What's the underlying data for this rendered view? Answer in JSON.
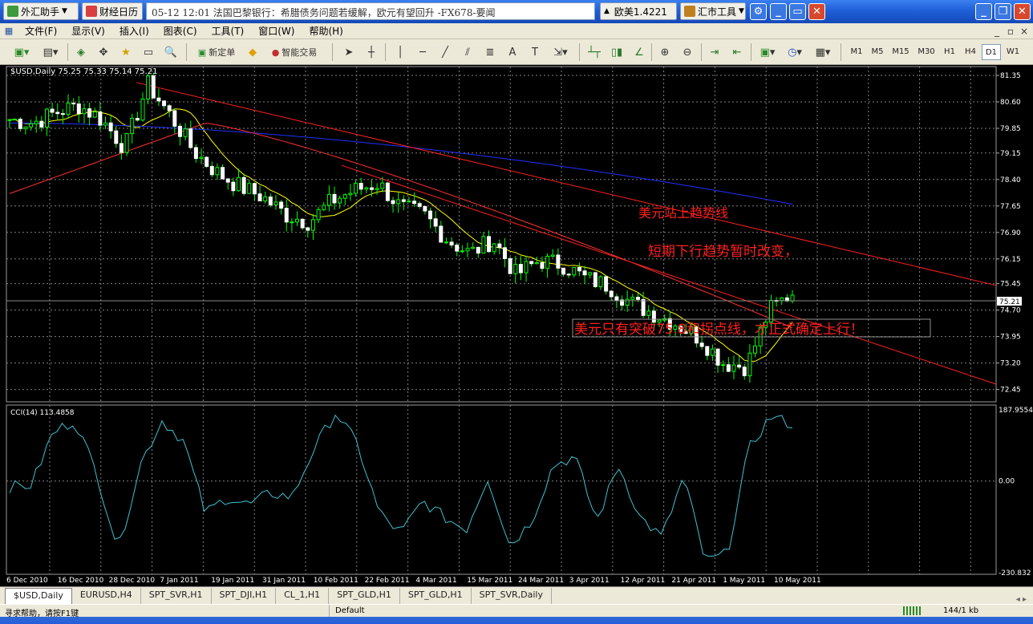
{
  "titlebar": {
    "app_button": "外汇助手",
    "calendar_button": "财经日历",
    "news_ticker": "05-12 12:01 法国巴黎银行：希腊债务问题若缓解，欧元有望回升  -FX678-要闻",
    "quote": "欧美1.4221",
    "tools_button": "汇市工具"
  },
  "menu": [
    "文件(F)",
    "显示(V)",
    "插入(I)",
    "图表(C)",
    "工具(T)",
    "窗口(W)",
    "帮助(H)"
  ],
  "toolbar": {
    "new_order": "新定单",
    "expert_trading": "智能交易",
    "periods": [
      "M1",
      "M5",
      "M15",
      "M30",
      "H1",
      "H4",
      "D1",
      "W1"
    ],
    "active_period": "D1"
  },
  "chart": {
    "header": "$USD,Daily  75.25 75.33 75.14 75.21",
    "price_labels": [
      "81.35",
      "80.60",
      "79.85",
      "79.15",
      "78.40",
      "77.65",
      "76.90",
      "76.15",
      "75.45",
      "74.70",
      "73.95",
      "73.20",
      "72.45"
    ],
    "current_price": "75.21",
    "date_labels": [
      "6 Dec 2010",
      "16 Dec 2010",
      "28 Dec 2010",
      "7 Jan 2011",
      "19 Jan 2011",
      "31 Jan 2011",
      "10 Feb 2011",
      "22 Feb 2011",
      "4 Mar 2011",
      "15 Mar 2011",
      "24 Mar 2011",
      "3 Apr 2011",
      "12 Apr 2011",
      "21 Apr 2011",
      "1 May 2011",
      "10 May 2011"
    ],
    "annotations": [
      "美元站上趋势线",
      "短期下行趋势暂时改变，",
      "美元只有突破75.8和拐点线，才正式确定上行！"
    ],
    "indicator_header": "CCI(14) 113.4858",
    "cci_labels": [
      "187.9554",
      "0.00",
      "-230.832"
    ],
    "colors": {
      "bull": "#00ff00",
      "bear": "#ffffff",
      "trendline": "#ff2020",
      "ma_short": "#ffff00",
      "ma_mid": "#ff3030",
      "ma_long": "#2030ff",
      "cci": "#40c0d0",
      "grid": "#808080"
    }
  },
  "chart_data": {
    "type": "candlestick",
    "title": "$USD,Daily",
    "ylim": [
      72.1,
      81.6
    ],
    "x": [
      "6 Dec 2010",
      "16 Dec 2010",
      "28 Dec 2010",
      "7 Jan 2011",
      "19 Jan 2011",
      "31 Jan 2011",
      "10 Feb 2011",
      "22 Feb 2011",
      "4 Mar 2011",
      "15 Mar 2011",
      "24 Mar 2011",
      "3 Apr 2011",
      "12 Apr 2011",
      "21 Apr 2011",
      "1 May 2011",
      "10 May 2011"
    ],
    "close_path": [
      80.1,
      80.0,
      80.3,
      80.5,
      80.1,
      79.3,
      81.1,
      80.2,
      79.2,
      78.6,
      78.2,
      77.9,
      77.4,
      77.2,
      77.8,
      78.1,
      78.3,
      77.6,
      77.4,
      76.7,
      76.3,
      76.7,
      75.7,
      76.1,
      76.0,
      75.6,
      75.4,
      74.9,
      74.6,
      74.3,
      73.9,
      73.2,
      73.1,
      74.7,
      75.2
    ],
    "indicator": {
      "name": "CCI(14)",
      "value": 113.4858,
      "ylim": [
        -230.832,
        187.9554
      ]
    },
    "cci_path": [
      -15,
      -10,
      120,
      150,
      20,
      -170,
      40,
      150,
      100,
      -80,
      -40,
      -60,
      -30,
      -40,
      80,
      170,
      90,
      -80,
      -130,
      -50,
      -90,
      -120,
      10,
      -160,
      -100,
      40,
      60,
      -100,
      40,
      -90,
      -140,
      10,
      -200,
      -180,
      80,
      160,
      140
    ]
  }
}
